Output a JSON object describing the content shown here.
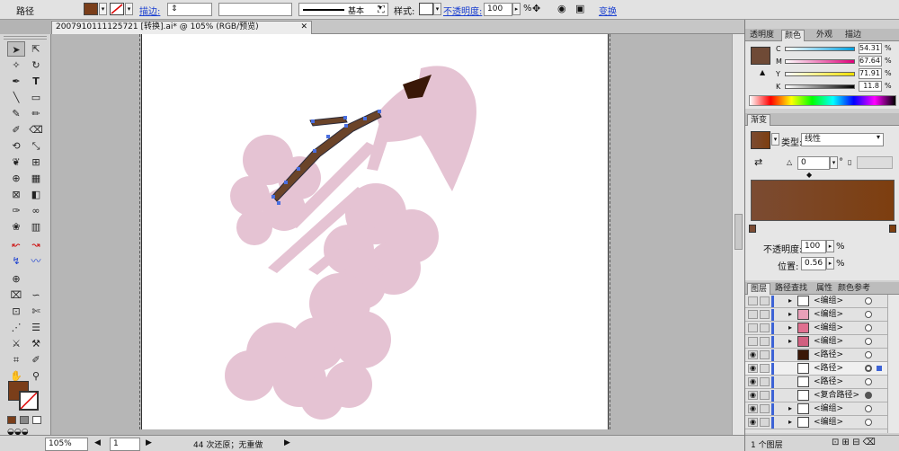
{
  "control_bar": {
    "object_type": "路径",
    "fill_color": "#7a3e1a",
    "stroke_label": "描边:",
    "stroke_profile_label": "基本",
    "style_label": "样式:",
    "opacity_label": "不透明度:",
    "opacity_value": "100",
    "opacity_unit": "%",
    "transform_label": "变换"
  },
  "document": {
    "tab_title": "2007910111125721 [转换].ai* @ 105% (RGB/预览)"
  },
  "status_bar": {
    "zoom": "105%",
    "artboard": "1",
    "history": "44 次还原；无重做"
  },
  "color_panel": {
    "tabs": [
      "透明度",
      "颜色",
      "外观",
      "描边"
    ],
    "active_tab": "颜色",
    "channels": [
      {
        "name": "C",
        "value": "54.31",
        "unit": "%"
      },
      {
        "name": "M",
        "value": "67.64",
        "unit": "%"
      },
      {
        "name": "Y",
        "value": "71.91",
        "unit": "%"
      },
      {
        "name": "K",
        "value": "11.8",
        "unit": "%"
      }
    ],
    "swatch": "#6f4a36"
  },
  "gradient_panel": {
    "title": "渐变",
    "type_label": "类型:",
    "type_value": "线性",
    "angle_value": "0",
    "angle_unit": "°",
    "opacity_label": "不透明度:",
    "opacity_value": "100",
    "location_label": "位置:",
    "location_value": "0.56",
    "percent": "%",
    "start_color": "#7b4b32",
    "end_color": "#7d3e0f"
  },
  "layers_panel": {
    "tabs": [
      "图层",
      "路径查找",
      "属性",
      "颜色参考"
    ],
    "active_tab": "图层",
    "rows": [
      {
        "name": "<编组>"
      },
      {
        "name": "<编组>"
      },
      {
        "name": "<编组>"
      },
      {
        "name": "<编组>"
      },
      {
        "name": "<路径>"
      },
      {
        "name": "<路径>"
      },
      {
        "name": "<路径>"
      },
      {
        "name": "<复合路径>"
      },
      {
        "name": "<编组>"
      },
      {
        "name": "<编组>"
      }
    ],
    "footer": "1 个图层"
  },
  "artwork": {
    "blossom_color": "#e5c3d3",
    "branch_color": "#6b4429",
    "tip_color": "#3a1808",
    "anchor_color": "#4a6fe0"
  }
}
